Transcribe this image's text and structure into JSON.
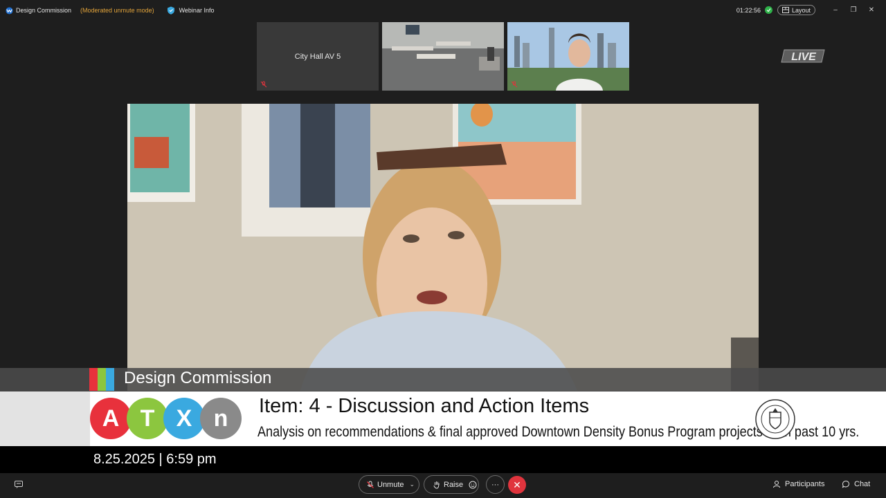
{
  "titlebar": {
    "app_title": "Design Commission",
    "mode": "(Moderated unmute mode)",
    "webinar_info": "Webinar Info",
    "timer": "01:22:56",
    "layout_label": "Layout"
  },
  "thumbnails": [
    {
      "name": "City Hall AV 5"
    },
    {
      "name": ""
    },
    {
      "name": ""
    }
  ],
  "live_badge": "LIVE",
  "lower_third": {
    "organization": "Design Commission",
    "stripe_colors": [
      "#e8313c",
      "#8cc63f",
      "#3aa9e0"
    ],
    "logo_letters": [
      {
        "letter": "A",
        "color": "#e8313c"
      },
      {
        "letter": "T",
        "color": "#8cc63f"
      },
      {
        "letter": "X",
        "color": "#3aa9e0"
      },
      {
        "letter": "n",
        "color": "#8a8a8a"
      }
    ],
    "item_title": "Item: 4 - Discussion and Action Items",
    "item_description": "Analysis on recommendations & final approved Downtown Density Bonus Program projects from past 10 yrs.",
    "date_time": "8.25.2025 | 6:59 pm"
  },
  "toolbar": {
    "unmute_label": "Unmute",
    "raise_label": "Raise",
    "more_label": "···",
    "end_label": "✕",
    "participants_label": "Participants",
    "chat_label": "Chat"
  }
}
